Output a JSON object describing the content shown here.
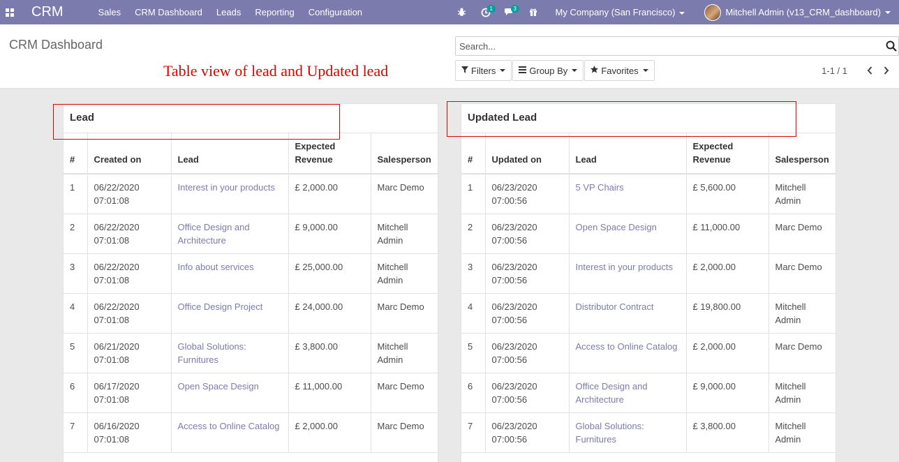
{
  "navbar": {
    "brand": "CRM",
    "menu": [
      "Sales",
      "CRM Dashboard",
      "Leads",
      "Reporting",
      "Configuration"
    ],
    "activity_badge": "1",
    "message_badge": "3",
    "company": "My Company (San Francisco)",
    "user": "Mitchell Admin (v13_CRM_dashboard)"
  },
  "control": {
    "title": "CRM Dashboard",
    "annotation": "Table view of lead and Updated lead",
    "search_placeholder": "Search...",
    "filters": "Filters",
    "group_by": "Group By",
    "favorites": "Favorites",
    "pager": "1-1 / 1"
  },
  "lead_table": {
    "title": "Lead",
    "headers": [
      "#",
      "Created on",
      "Lead",
      "Expected Revenue",
      "Salesperson"
    ],
    "rows": [
      [
        "1",
        "06/22/2020 07:01:08",
        "Interest in your products",
        "£ 2,000.00",
        "Marc Demo"
      ],
      [
        "2",
        "06/22/2020 07:01:08",
        "Office Design and Architecture",
        "£ 9,000.00",
        "Mitchell Admin"
      ],
      [
        "3",
        "06/22/2020 07:01:08",
        "Info about services",
        "£ 25,000.00",
        "Mitchell Admin"
      ],
      [
        "4",
        "06/22/2020 07:01:08",
        "Office Design Project",
        "£ 24,000.00",
        "Marc Demo"
      ],
      [
        "5",
        "06/21/2020 07:01:08",
        "Global Solutions: Furnitures",
        "£ 3,800.00",
        "Mitchell Admin"
      ],
      [
        "6",
        "06/17/2020 07:01:08",
        "Open Space Design",
        "£ 11,000.00",
        "Marc Demo"
      ],
      [
        "7",
        "06/16/2020 07:01:08",
        "Access to Online Catalog",
        "£ 2,000.00",
        "Marc Demo"
      ]
    ]
  },
  "updated_table": {
    "title": "Updated Lead",
    "headers": [
      "#",
      "Updated on",
      "Lead",
      "Expected Revenue",
      "Salesperson"
    ],
    "rows": [
      [
        "1",
        "06/23/2020 07:00:56",
        "5 VP Chairs",
        "£ 5,600.00",
        "Mitchell Admin"
      ],
      [
        "2",
        "06/23/2020 07:00:56",
        "Open Space Design",
        "£ 11,000.00",
        "Marc Demo"
      ],
      [
        "3",
        "06/23/2020 07:00:56",
        "Interest in your products",
        "£ 2,000.00",
        "Marc Demo"
      ],
      [
        "4",
        "06/23/2020 07:00:56",
        "Distributor Contract",
        "£ 19,800.00",
        "Mitchell Admin"
      ],
      [
        "5",
        "06/23/2020 07:00:56",
        "Access to Online Catalog",
        "£ 2,000.00",
        "Marc Demo"
      ],
      [
        "6",
        "06/23/2020 07:00:56",
        "Office Design and Architecture",
        "£ 9,000.00",
        "Mitchell Admin"
      ],
      [
        "7",
        "06/23/2020 07:00:56",
        "Global Solutions: Furnitures",
        "£ 3,800.00",
        "Mitchell Admin"
      ]
    ]
  },
  "colors": {
    "navbar": "#7c7bad",
    "link": "#7c7bad",
    "badge": "#00a09d",
    "annotation": "#e00000"
  }
}
